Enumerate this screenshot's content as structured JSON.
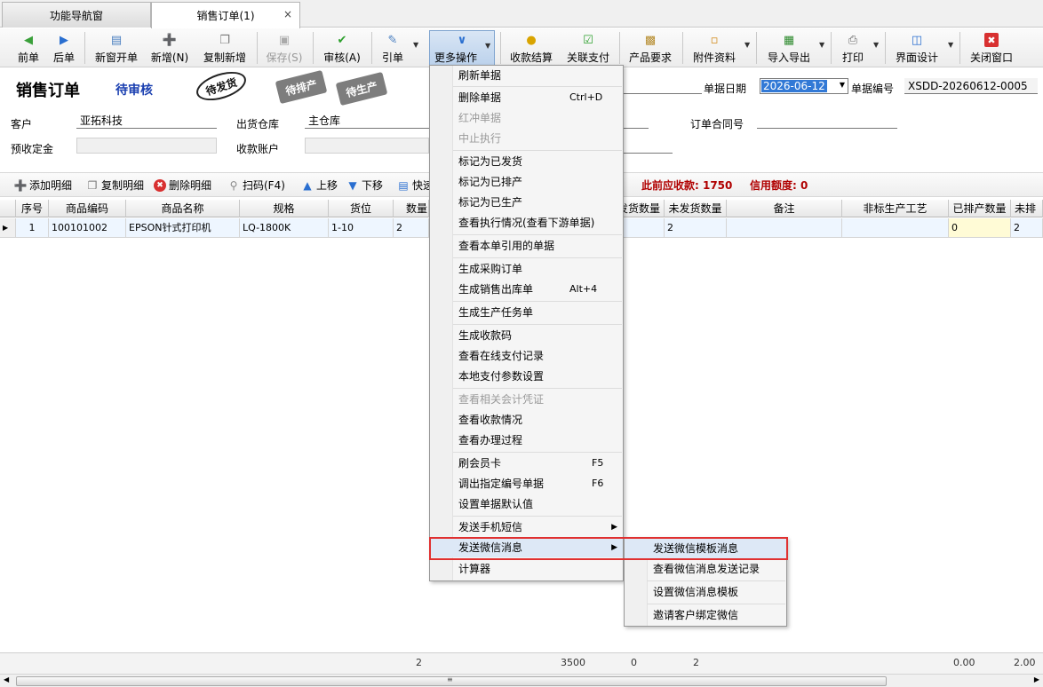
{
  "tabs": [
    {
      "label": "功能导航窗"
    },
    {
      "label": "销售订单(1)",
      "close": "×"
    }
  ],
  "toolbar": {
    "prev": "前单",
    "next": "后单",
    "new_window": "新窗开单",
    "add": "新增(N)",
    "copy_add": "复制新增",
    "save": "保存(S)",
    "audit": "审核(A)",
    "ref": "引单",
    "more": "更多操作",
    "collect": "收款结算",
    "link_pay": "关联支付",
    "product_req": "产品要求",
    "attachments": "附件资料",
    "import_export": "导入导出",
    "print": "打印",
    "ui_design": "界面设计",
    "close_window": "关闭窗口"
  },
  "doc": {
    "title": "销售订单",
    "status": "待审核",
    "stamps": [
      "待发货",
      "待排产",
      "待生产"
    ],
    "date_label": "单据日期",
    "date_value": "2026-06-12",
    "number_label": "单据编号",
    "number_value": "XSDD-20260612-0005",
    "customer_label": "客户",
    "customer_value": "亚拓科技",
    "warehouse_label": "出货仓库",
    "warehouse_value": "主仓库",
    "contract_label": "订单合同号",
    "deposit_label": "预收定金",
    "account_label": "收款账户"
  },
  "detail_toolbar": {
    "add": "添加明细",
    "copy": "复制明细",
    "delete": "删除明细",
    "scan": "扫码(F4)",
    "up": "上移",
    "down": "下移",
    "quick": "快速",
    "receivable": "此前应收款: 1750",
    "credit": "信用额度: 0"
  },
  "grid": {
    "headers": [
      "序号",
      "商品编码",
      "商品名称",
      "规格",
      "货位",
      "数量",
      "发货数量",
      "未发货数量",
      "备注",
      "非标生产工艺",
      "已排产数量",
      "未排"
    ],
    "row": {
      "seq": "1",
      "code": "100101002",
      "name": "EPSON针式打印机",
      "spec": "LQ-1800K",
      "loc": "1-10",
      "qty": "2",
      "unshipped": "2",
      "scheduled": "0",
      "unscheduled": "2"
    },
    "footer": {
      "qty": "2",
      "amount": "3500",
      "shipped": "0",
      "unshipped": "2",
      "scheduled": "0.00",
      "unscheduled": "2.00"
    }
  },
  "menu": {
    "items": [
      "刷新单据",
      "删除单据",
      "红冲单据",
      "中止执行",
      "标记为已发货",
      "标记为已排产",
      "标记为已生产",
      "查看执行情况(查看下游单据)",
      "查看本单引用的单据",
      "生成采购订单",
      "生成销售出库单",
      "生成生产任务单",
      "生成收款码",
      "查看在线支付记录",
      "本地支付参数设置",
      "查看相关会计凭证",
      "查看收款情况",
      "查看办理过程",
      "刷会员卡",
      "调出指定编号单据",
      "设置单据默认值",
      "发送手机短信",
      "发送微信消息",
      "计算器"
    ],
    "shortcuts": {
      "delete": "Ctrl+D",
      "outbound": "Alt+4",
      "member": "F5",
      "recall": "F6"
    }
  },
  "submenu": {
    "items": [
      "发送微信模板消息",
      "查看微信消息发送记录",
      "设置微信消息模板",
      "邀请客户绑定微信"
    ]
  },
  "colors": {
    "highlight_border": "#e03030",
    "status_blue": "#1a3fb0",
    "alert_red": "#b00000",
    "selection": "#3279d6"
  }
}
